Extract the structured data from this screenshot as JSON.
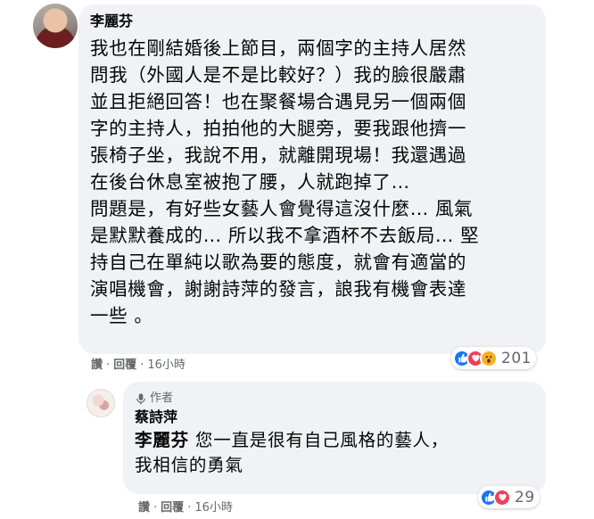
{
  "comment": {
    "author": "李麗芬",
    "lines": [
      "我也在剛結婚後上節目，兩個字的主持人居然",
      "問我（外國人是不是比較好？）我的臉很嚴肅",
      "並且拒絕回答！也在聚餐場合遇見另一個兩個",
      "字的主持人，拍拍他的大腿旁，要我跟他擠一",
      "張椅子坐，我說不用，就離開現場！我還遇過",
      "在後台休息室被抱了腰，人就跑掉了…",
      "問題是，有好些女藝人會覺得這沒什麼… 風氣",
      "是默默養成的… 所以我不拿酒杯不去飯局… 堅",
      "持自己在單純以歌為要的態度，就會有適當的",
      "演唱機會，謝謝詩萍的發言，誏我有機會表達",
      "一些 。"
    ],
    "reactions_count": "201",
    "actions": {
      "like": "讚",
      "sep1": "·",
      "reply": "回覆",
      "sep2": "·",
      "time": "16小時"
    }
  },
  "reply": {
    "badge": "作者",
    "author": "蔡詩萍",
    "mention": "李麗芬",
    "line1": " 您一直是很有自己風格的藝人，",
    "line2": "我相信的勇氣",
    "reactions_count": "29",
    "actions": {
      "like": "讚",
      "sep1": "·",
      "reply": "回覆",
      "sep2": "·",
      "time": "16小時"
    }
  },
  "colors": {
    "bubble": "#f0f2f5",
    "like": "#1877f2",
    "love": "#f33e58",
    "wow": "#f7b125",
    "meta": "#65676b"
  }
}
